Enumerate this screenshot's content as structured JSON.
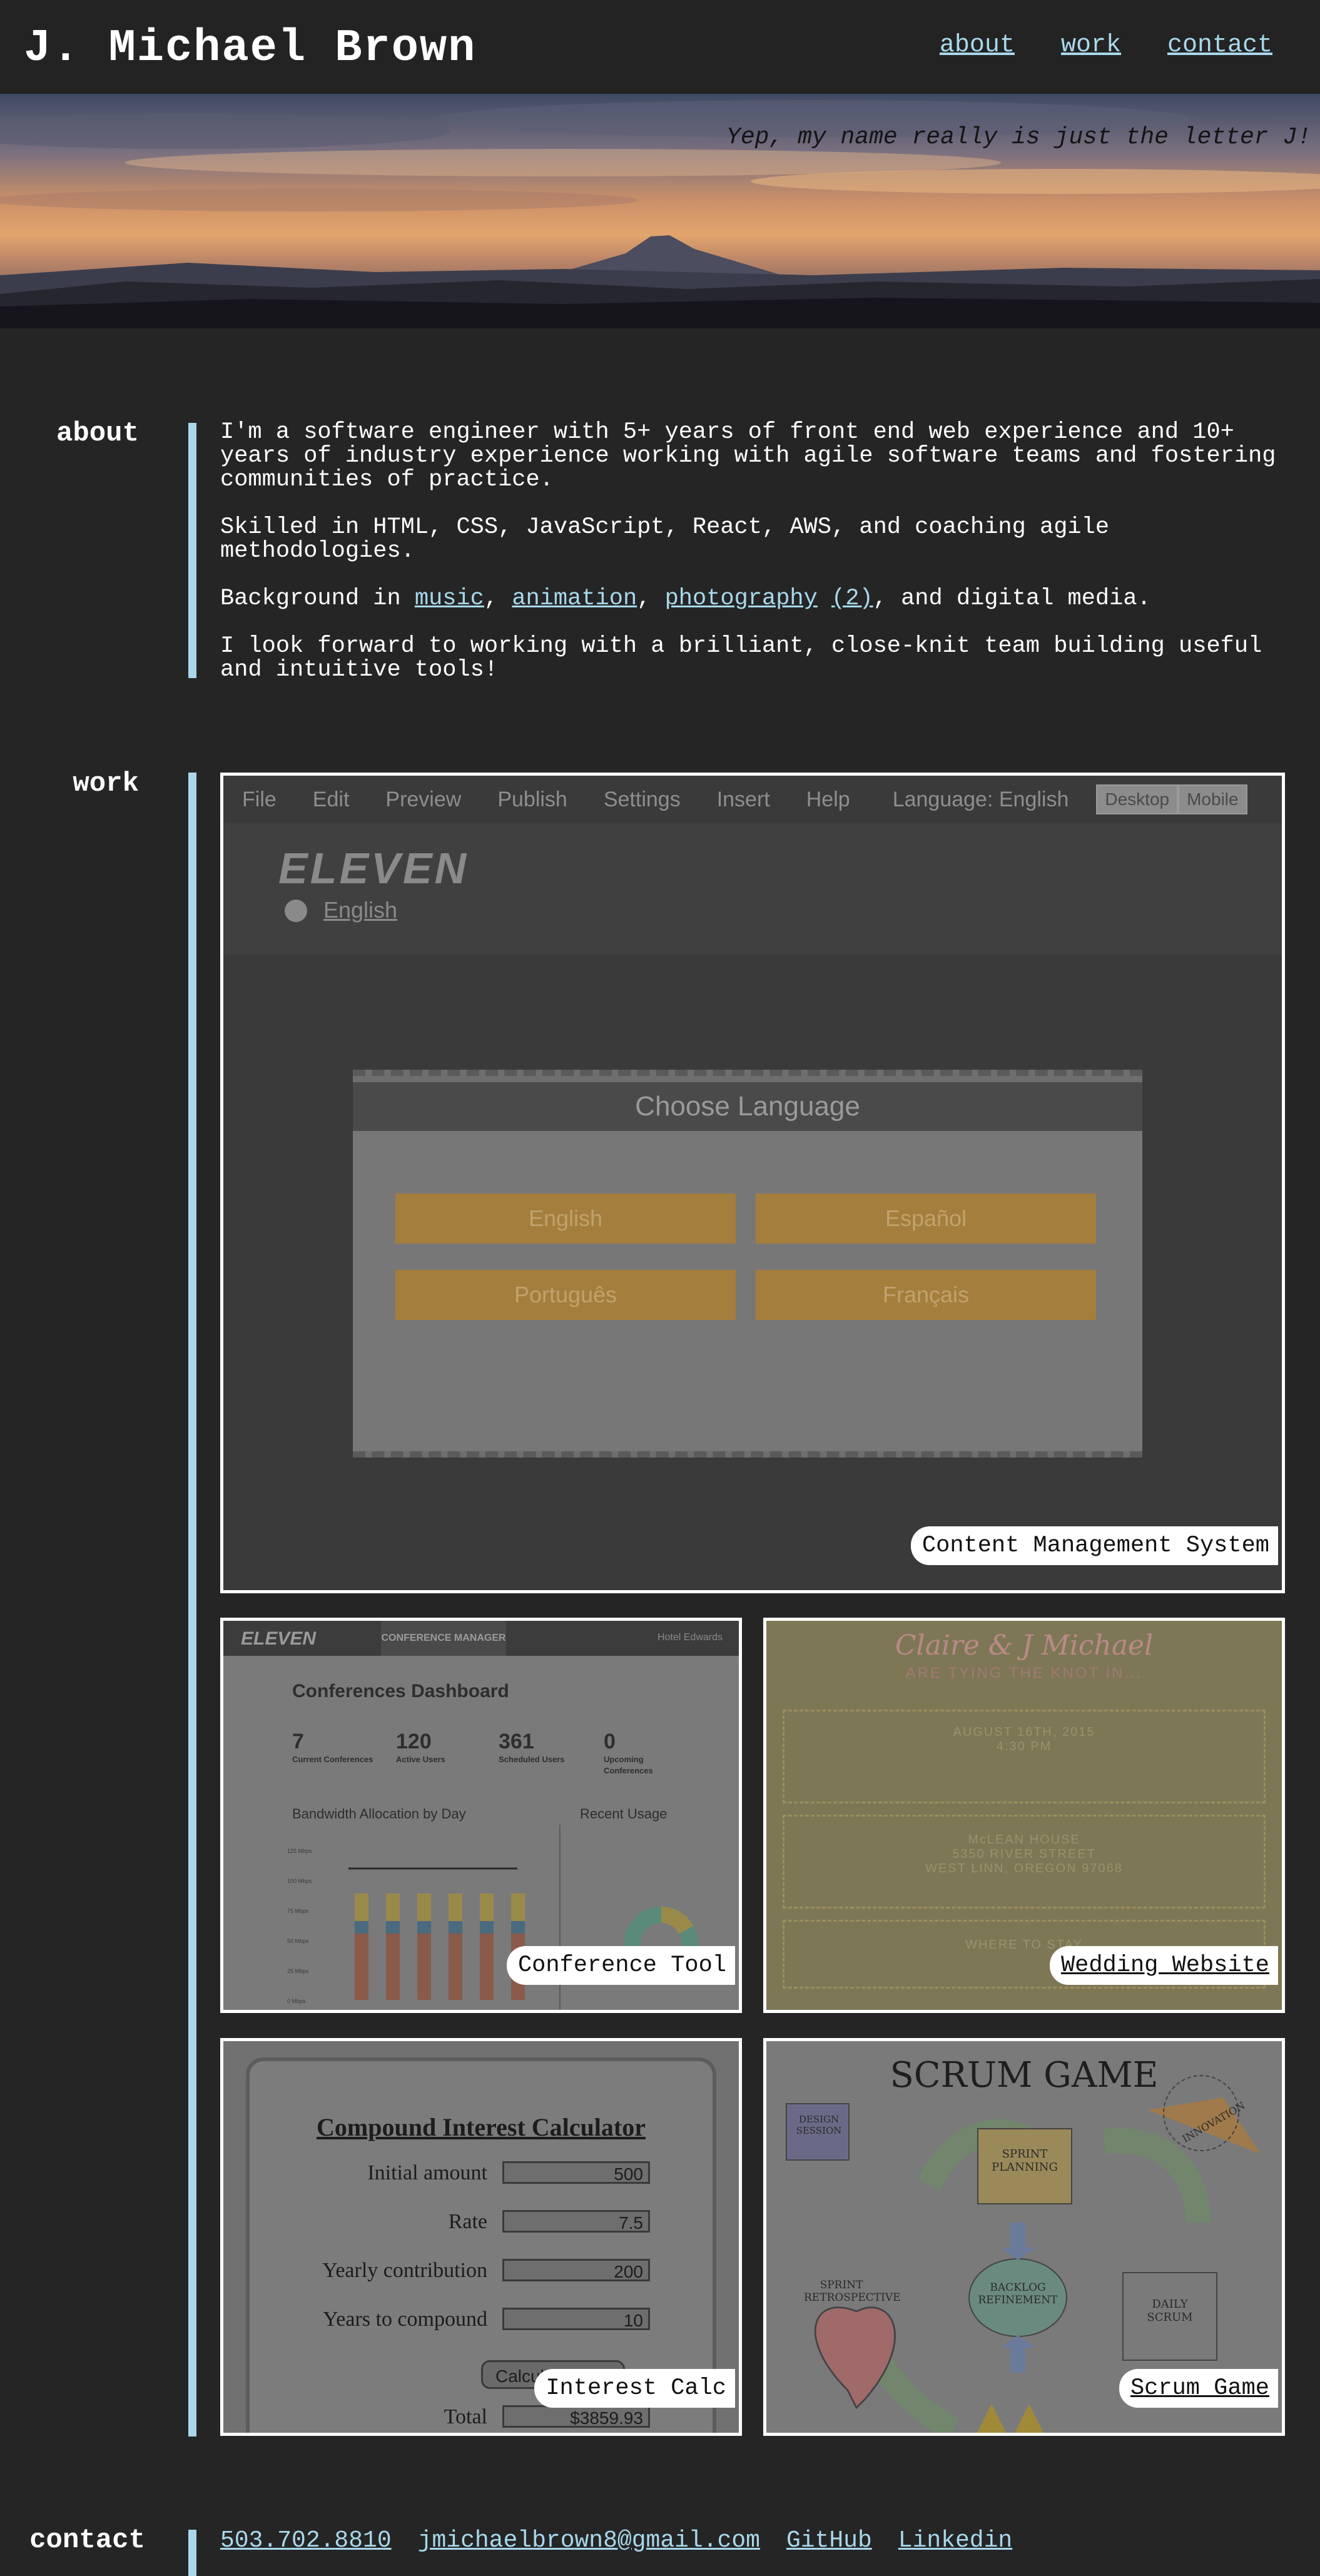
{
  "header": {
    "title": "J. Michael Brown",
    "nav": [
      "about",
      "work",
      "contact"
    ]
  },
  "hero": {
    "tagline": "Yep, my name really is just the letter J!"
  },
  "about": {
    "heading": "about",
    "p1": "I'm a software engineer with 5+ years of front end web experience and 10+ years of industry experience working with agile software teams and fostering communities of practice.",
    "p2": "Skilled in HTML, CSS, JavaScript, React, AWS, and coaching agile methodologies.",
    "p3_prefix": "Background in ",
    "links": [
      "music",
      "animation",
      "photography",
      "(2)"
    ],
    "p3_suffix": ", and digital media.",
    "p4": "I look forward to working with a brilliant, close-knit team building useful and intuitive tools!"
  },
  "work": {
    "heading": "work",
    "cms": {
      "label": "Content Management System",
      "menu": [
        "File",
        "Edit",
        "Preview",
        "Publish",
        "Settings",
        "Insert",
        "Help"
      ],
      "language_label": "Language: English",
      "view_buttons": [
        "Desktop",
        "Mobile"
      ],
      "logo": "ELEVEN",
      "language_link": "English",
      "modal_title": "Choose Language",
      "languages": [
        "English",
        "Español",
        "Português",
        "Français"
      ]
    },
    "conference": {
      "label": "Conference Tool",
      "logo": "ELEVEN",
      "tab": "CONFERENCE MANAGER",
      "user": "Hotel Edwards",
      "dashboard_title": "Conferences Dashboard",
      "stats": [
        {
          "value": "7",
          "label": "Current Conferences"
        },
        {
          "value": "120",
          "label": "Active Users"
        },
        {
          "value": "361",
          "label": "Scheduled Users"
        },
        {
          "value": "0",
          "label": "Upcoming Conferences"
        }
      ],
      "bandwidth_title": "Bandwidth Allocation by Day",
      "usage_title": "Recent Usage",
      "y_ticks": [
        "125 Mbps",
        "100 Mbps",
        "75 Mbps",
        "50 Mbps",
        "25 Mbps",
        "0 Mbps"
      ]
    },
    "wedding": {
      "label": "Wedding Website",
      "names": "Claire & J Michael",
      "subtitle": "ARE TYING THE KNOT IN...",
      "date": "AUGUST 16TH, 2015",
      "time": "4:30 PM",
      "venue_lines": [
        "McLEAN HOUSE",
        "5350 RIVER STREET",
        "WEST LINN, OREGON 97068"
      ],
      "where": "WHERE TO STAY"
    },
    "interest": {
      "label": "Interest Calc",
      "title": "Compound Interest Calculator",
      "fields": [
        {
          "label": "Initial amount",
          "value": "500"
        },
        {
          "label": "Rate",
          "value": "7.5"
        },
        {
          "label": "Yearly contribution",
          "value": "200"
        },
        {
          "label": "Years to compound",
          "value": "10"
        }
      ],
      "button": "Calculate",
      "total_label": "Total",
      "total_value": "$3859.93"
    },
    "scrum": {
      "label": "Scrum Game",
      "title": "SCRUM GAME",
      "nodes": [
        "DESIGN SESSION",
        "SPRINT PLANNING",
        "INNOVATION",
        "SPRINT RETROSPECTIVE",
        "BACKLOG REFINEMENT",
        "DAILY SCRUM"
      ]
    }
  },
  "contact": {
    "heading": "contact",
    "links": [
      "503.702.8810",
      "jmichaelbrown8@gmail.com",
      "GitHub",
      "Linkedin"
    ]
  },
  "colors": {
    "background": "#252526",
    "accent": "#a9d8ea",
    "text": "#ffffff"
  }
}
